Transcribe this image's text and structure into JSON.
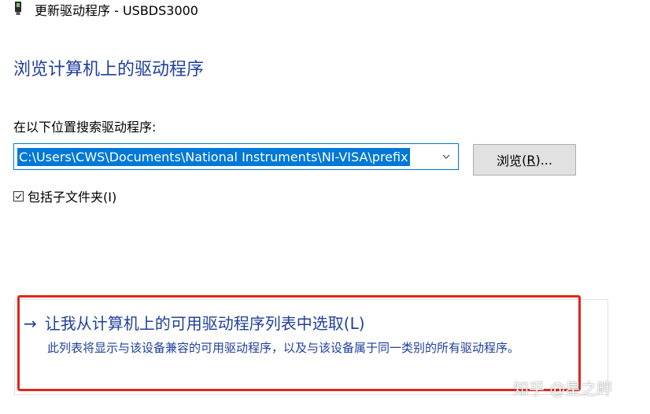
{
  "window": {
    "title": "更新驱动程序 - USBDS3000",
    "icon": "usb-device-icon"
  },
  "heading": "浏览计算机上的驱动程序",
  "search": {
    "label": "在以下位置搜索驱动程序:",
    "path_value": "C:\\Users\\CWS\\Documents\\National Instruments\\NI-VISA\\prefix",
    "dropdown_icon": "chevron-down-icon"
  },
  "browse_button": {
    "label": "浏览",
    "shortcut": "R",
    "label_suffix": "..."
  },
  "subfolders": {
    "checked": true,
    "label": "包括子文件夹(I)"
  },
  "pick_option": {
    "arrow": "→",
    "title": "让我从计算机上的可用驱动程序列表中选取(L)",
    "description": "此列表将显示与该设备兼容的可用驱动程序，以及与该设备属于同一类别的所有驱动程序。"
  },
  "watermark": "知乎 @星之畔",
  "colors": {
    "heading": "#1f3f9b",
    "selection": "#0078d7",
    "highlight_border": "#e1261c",
    "button_bg": "#e1e1e1"
  }
}
